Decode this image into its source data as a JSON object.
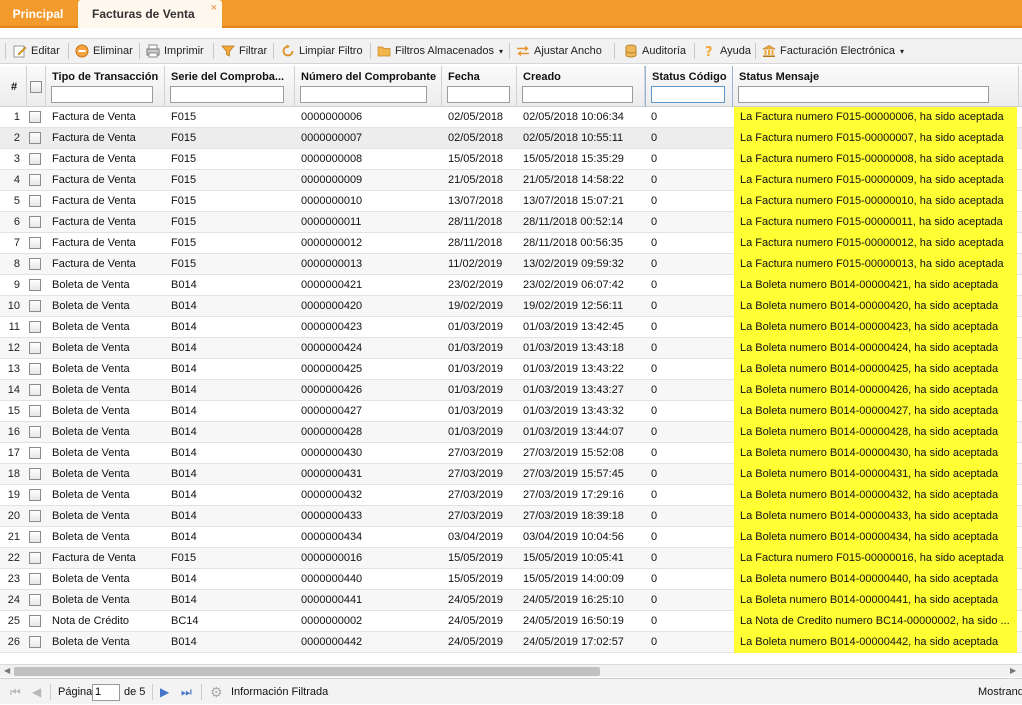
{
  "tabs": [
    {
      "label": "Principal"
    },
    {
      "label": "Facturas de Venta",
      "close": "×"
    }
  ],
  "toolbar": {
    "editar": "Editar",
    "eliminar": "Eliminar",
    "imprimir": "Imprimir",
    "filtrar": "Filtrar",
    "limpiar_filtro": "Limpiar Filtro",
    "filtros_almacenados": "Filtros Almacenados",
    "ajustar_ancho": "Ajustar Ancho",
    "auditoria": "Auditoría",
    "ayuda": "Ayuda",
    "facturacion_electronica": "Facturación Electrónica",
    "caret": "▾"
  },
  "columns": {
    "hash": "#",
    "tipo": "Tipo de Transacción",
    "serie": "Serie del Comproba...",
    "numero": "Número del Comprobante",
    "fecha": "Fecha",
    "creado": "Creado",
    "status_codigo": "Status Código",
    "status_mensaje": "Status Mensaje"
  },
  "rows": [
    {
      "n": "1",
      "tipo": "Factura de Venta",
      "serie": "F015",
      "numero": "0000000006",
      "fecha": "02/05/2018",
      "creado": "02/05/2018 10:06:34",
      "codigo": "0",
      "mensaje": "La Factura numero F015-00000006, ha sido aceptada"
    },
    {
      "n": "2",
      "tipo": "Factura de Venta",
      "serie": "F015",
      "numero": "0000000007",
      "fecha": "02/05/2018",
      "creado": "02/05/2018 10:55:11",
      "codigo": "0",
      "mensaje": "La Factura numero F015-00000007, ha sido aceptada"
    },
    {
      "n": "3",
      "tipo": "Factura de Venta",
      "serie": "F015",
      "numero": "0000000008",
      "fecha": "15/05/2018",
      "creado": "15/05/2018 15:35:29",
      "codigo": "0",
      "mensaje": "La Factura numero F015-00000008, ha sido aceptada"
    },
    {
      "n": "4",
      "tipo": "Factura de Venta",
      "serie": "F015",
      "numero": "0000000009",
      "fecha": "21/05/2018",
      "creado": "21/05/2018 14:58:22",
      "codigo": "0",
      "mensaje": "La Factura numero F015-00000009, ha sido aceptada"
    },
    {
      "n": "5",
      "tipo": "Factura de Venta",
      "serie": "F015",
      "numero": "0000000010",
      "fecha": "13/07/2018",
      "creado": "13/07/2018 15:07:21",
      "codigo": "0",
      "mensaje": "La Factura numero F015-00000010, ha sido aceptada"
    },
    {
      "n": "6",
      "tipo": "Factura de Venta",
      "serie": "F015",
      "numero": "0000000011",
      "fecha": "28/11/2018",
      "creado": "28/11/2018 00:52:14",
      "codigo": "0",
      "mensaje": "La Factura numero F015-00000011, ha sido aceptada"
    },
    {
      "n": "7",
      "tipo": "Factura de Venta",
      "serie": "F015",
      "numero": "0000000012",
      "fecha": "28/11/2018",
      "creado": "28/11/2018 00:56:35",
      "codigo": "0",
      "mensaje": "La Factura numero F015-00000012, ha sido aceptada"
    },
    {
      "n": "8",
      "tipo": "Factura de Venta",
      "serie": "F015",
      "numero": "0000000013",
      "fecha": "11/02/2019",
      "creado": "13/02/2019 09:59:32",
      "codigo": "0",
      "mensaje": "La Factura numero F015-00000013, ha sido aceptada"
    },
    {
      "n": "9",
      "tipo": "Boleta de Venta",
      "serie": "B014",
      "numero": "0000000421",
      "fecha": "23/02/2019",
      "creado": "23/02/2019 06:07:42",
      "codigo": "0",
      "mensaje": "La Boleta numero B014-00000421, ha sido aceptada"
    },
    {
      "n": "10",
      "tipo": "Boleta de Venta",
      "serie": "B014",
      "numero": "0000000420",
      "fecha": "19/02/2019",
      "creado": "19/02/2019 12:56:11",
      "codigo": "0",
      "mensaje": "La Boleta numero B014-00000420, ha sido aceptada"
    },
    {
      "n": "11",
      "tipo": "Boleta de Venta",
      "serie": "B014",
      "numero": "0000000423",
      "fecha": "01/03/2019",
      "creado": "01/03/2019 13:42:45",
      "codigo": "0",
      "mensaje": "La Boleta numero B014-00000423, ha sido aceptada"
    },
    {
      "n": "12",
      "tipo": "Boleta de Venta",
      "serie": "B014",
      "numero": "0000000424",
      "fecha": "01/03/2019",
      "creado": "01/03/2019 13:43:18",
      "codigo": "0",
      "mensaje": "La Boleta numero B014-00000424, ha sido aceptada"
    },
    {
      "n": "13",
      "tipo": "Boleta de Venta",
      "serie": "B014",
      "numero": "0000000425",
      "fecha": "01/03/2019",
      "creado": "01/03/2019 13:43:22",
      "codigo": "0",
      "mensaje": "La Boleta numero B014-00000425, ha sido aceptada"
    },
    {
      "n": "14",
      "tipo": "Boleta de Venta",
      "serie": "B014",
      "numero": "0000000426",
      "fecha": "01/03/2019",
      "creado": "01/03/2019 13:43:27",
      "codigo": "0",
      "mensaje": "La Boleta numero B014-00000426, ha sido aceptada"
    },
    {
      "n": "15",
      "tipo": "Boleta de Venta",
      "serie": "B014",
      "numero": "0000000427",
      "fecha": "01/03/2019",
      "creado": "01/03/2019 13:43:32",
      "codigo": "0",
      "mensaje": "La Boleta numero B014-00000427, ha sido aceptada"
    },
    {
      "n": "16",
      "tipo": "Boleta de Venta",
      "serie": "B014",
      "numero": "0000000428",
      "fecha": "01/03/2019",
      "creado": "01/03/2019 13:44:07",
      "codigo": "0",
      "mensaje": "La Boleta numero B014-00000428, ha sido aceptada"
    },
    {
      "n": "17",
      "tipo": "Boleta de Venta",
      "serie": "B014",
      "numero": "0000000430",
      "fecha": "27/03/2019",
      "creado": "27/03/2019 15:52:08",
      "codigo": "0",
      "mensaje": "La Boleta numero B014-00000430, ha sido aceptada"
    },
    {
      "n": "18",
      "tipo": "Boleta de Venta",
      "serie": "B014",
      "numero": "0000000431",
      "fecha": "27/03/2019",
      "creado": "27/03/2019 15:57:45",
      "codigo": "0",
      "mensaje": "La Boleta numero B014-00000431, ha sido aceptada"
    },
    {
      "n": "19",
      "tipo": "Boleta de Venta",
      "serie": "B014",
      "numero": "0000000432",
      "fecha": "27/03/2019",
      "creado": "27/03/2019 17:29:16",
      "codigo": "0",
      "mensaje": "La Boleta numero B014-00000432, ha sido aceptada"
    },
    {
      "n": "20",
      "tipo": "Boleta de Venta",
      "serie": "B014",
      "numero": "0000000433",
      "fecha": "27/03/2019",
      "creado": "27/03/2019 18:39:18",
      "codigo": "0",
      "mensaje": "La Boleta numero B014-00000433, ha sido aceptada"
    },
    {
      "n": "21",
      "tipo": "Boleta de Venta",
      "serie": "B014",
      "numero": "0000000434",
      "fecha": "03/04/2019",
      "creado": "03/04/2019 10:04:56",
      "codigo": "0",
      "mensaje": "La Boleta numero B014-00000434, ha sido aceptada"
    },
    {
      "n": "22",
      "tipo": "Factura de Venta",
      "serie": "F015",
      "numero": "0000000016",
      "fecha": "15/05/2019",
      "creado": "15/05/2019 10:05:41",
      "codigo": "0",
      "mensaje": "La Factura numero F015-00000016, ha sido aceptada"
    },
    {
      "n": "23",
      "tipo": "Boleta de Venta",
      "serie": "B014",
      "numero": "0000000440",
      "fecha": "15/05/2019",
      "creado": "15/05/2019 14:00:09",
      "codigo": "0",
      "mensaje": "La Boleta numero B014-00000440, ha sido aceptada"
    },
    {
      "n": "24",
      "tipo": "Boleta de Venta",
      "serie": "B014",
      "numero": "0000000441",
      "fecha": "24/05/2019",
      "creado": "24/05/2019 16:25:10",
      "codigo": "0",
      "mensaje": "La Boleta numero B014-00000441, ha sido aceptada"
    },
    {
      "n": "25",
      "tipo": "Nota de Crédito",
      "serie": "BC14",
      "numero": "0000000002",
      "fecha": "24/05/2019",
      "creado": "24/05/2019 16:50:19",
      "codigo": "0",
      "mensaje": "La Nota de Credito numero BC14-00000002, ha sido ..."
    },
    {
      "n": "26",
      "tipo": "Boleta de Venta",
      "serie": "B014",
      "numero": "0000000442",
      "fecha": "24/05/2019",
      "creado": "24/05/2019 17:02:57",
      "codigo": "0",
      "mensaje": "La Boleta numero B014-00000442, ha sido aceptada"
    }
  ],
  "pager": {
    "pagina_label": "Página",
    "page_value": "1",
    "de_label": "de 5",
    "info_filtrada": "Información Filtrada",
    "mostrando": "Mostrand"
  },
  "colors": {
    "tabbar": "#f39a2c",
    "highlight": "#ffff33",
    "pager_link": "#4477c9"
  }
}
